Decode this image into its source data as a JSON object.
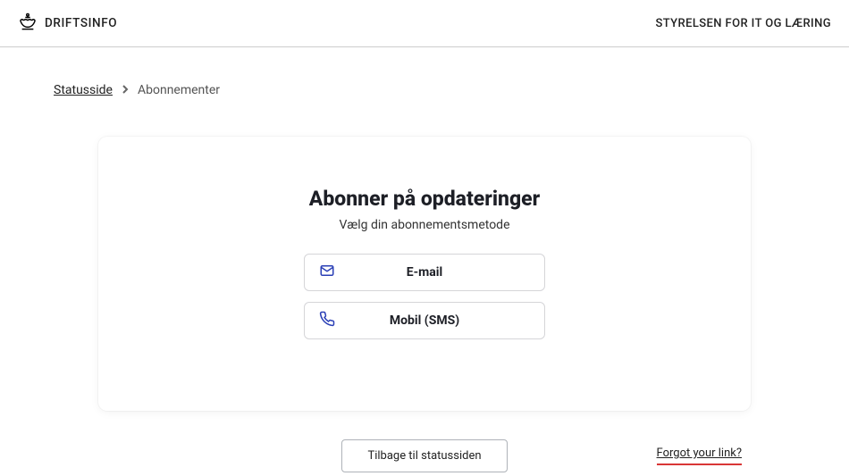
{
  "header": {
    "brand": "DRIFTSINFO",
    "organization": "STYRELSEN FOR IT OG LÆRING"
  },
  "breadcrumb": {
    "root": "Statusside",
    "separator": "❯",
    "current": "Abonnementer"
  },
  "card": {
    "title": "Abonner på opdateringer",
    "subtitle": "Vælg din abonnementsmetode",
    "options": [
      {
        "label": "E-mail",
        "icon": "email-icon"
      },
      {
        "label": "Mobil (SMS)",
        "icon": "phone-icon"
      }
    ]
  },
  "footer": {
    "back_label": "Tilbage til statussiden",
    "forgot_label": "Forgot your link?"
  }
}
